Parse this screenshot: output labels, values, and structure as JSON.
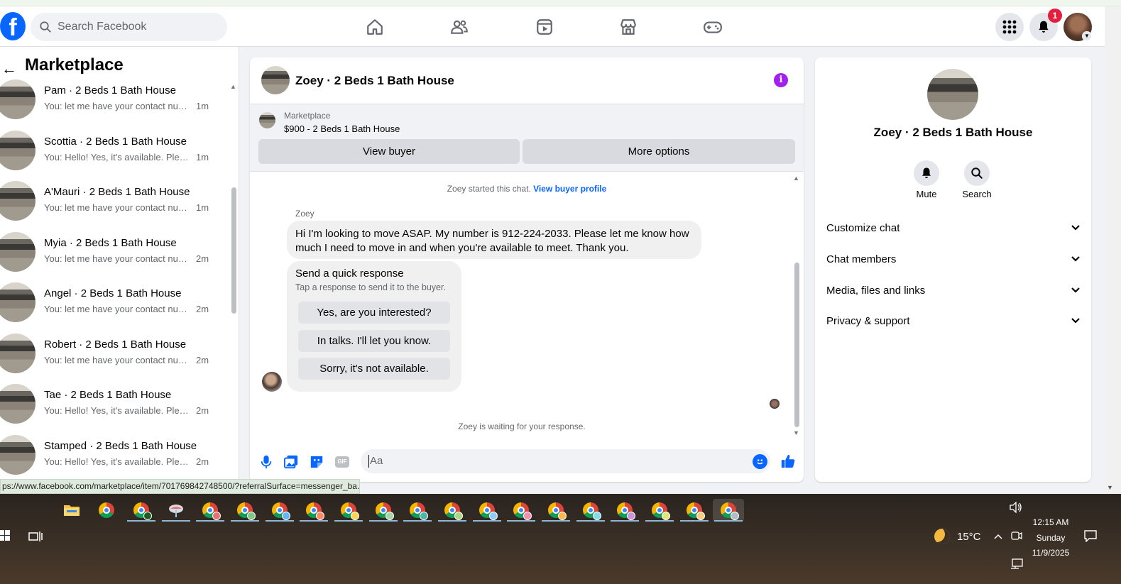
{
  "header": {
    "search_placeholder": "Search Facebook",
    "notification_count": "1",
    "logo_letter": "f"
  },
  "sidebar": {
    "back": "←",
    "title": "Marketplace",
    "conversations": [
      {
        "name": "Pam · 2 Beds 1 Bath House",
        "preview": "You: let me have your contact num...",
        "time": "1m"
      },
      {
        "name": "Scottia · 2 Beds 1 Bath House",
        "preview": "You: Hello! Yes, it's available. Pleas...",
        "time": "1m"
      },
      {
        "name": "A'Mauri · 2 Beds 1 Bath House",
        "preview": "You: let me have your contact num...",
        "time": "1m"
      },
      {
        "name": "Myia · 2 Beds 1 Bath House",
        "preview": "You: let me have your contact num...",
        "time": "2m"
      },
      {
        "name": "Angel · 2 Beds 1 Bath House",
        "preview": "You: let me have your contact num...",
        "time": "2m"
      },
      {
        "name": "Robert · 2 Beds 1 Bath House",
        "preview": "You: let me have your contact num...",
        "time": "2m"
      },
      {
        "name": "Tae · 2 Beds 1 Bath House",
        "preview": "You: Hello! Yes, it's available. Pleas...",
        "time": "2m"
      },
      {
        "name": "Stamped · 2 Beds 1 Bath House",
        "preview": "You: Hello! Yes, it's available. Pleas...",
        "time": "2m"
      }
    ]
  },
  "chat": {
    "title": "Zoey · 2 Beds 1 Bath House",
    "info_glyph": "i",
    "listing_source": "Marketplace",
    "listing_item": "$900 - 2 Beds 1 Bath House",
    "view_buyer": "View buyer",
    "more_options": "More options",
    "started_text": "Zoey started this chat.",
    "started_link": "View buyer profile",
    "sender": "Zoey",
    "message": "Hi I'm looking to move ASAP. My number is 912-224-2033. Please let me know how much I need to move in and when you're available to meet. Thank you.",
    "quick_title": "Send a quick response",
    "quick_sub": "Tap a response to send it to the buyer.",
    "quick_replies": [
      "Yes, are you interested?",
      "In talks. I'll let you know.",
      "Sorry, it's not available."
    ],
    "waiting": "Zoey is waiting for your response.",
    "composer_placeholder": "Aa",
    "gif_label": "GIF"
  },
  "right_panel": {
    "name": "Zoey · 2 Beds 1 Bath House",
    "mute": "Mute",
    "search": "Search",
    "rows": [
      "Customize chat",
      "Chat members",
      "Media, files and links",
      "Privacy & support"
    ]
  },
  "status_url": "ps://www.facebook.com/marketplace/item/701769842748500/?referralSurface=messenger_ba...",
  "taskbar": {
    "temperature": "15°C",
    "time": "12:15 AM",
    "day": "Sunday",
    "date": "11/9/2025"
  },
  "colors": {
    "facebook_blue": "#0866ff",
    "info_purple": "#a020f0",
    "badge_red": "#e41e3f"
  }
}
